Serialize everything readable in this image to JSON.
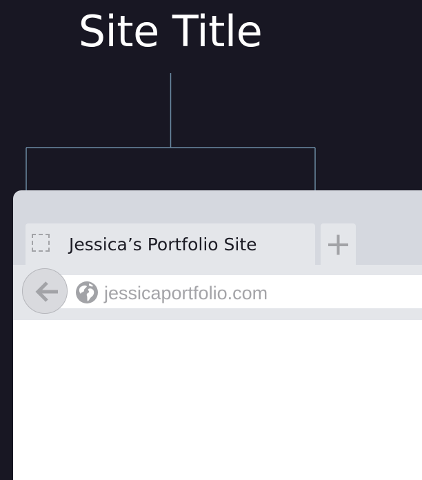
{
  "annotation": {
    "label": "Site Title"
  },
  "browser": {
    "active_tab": {
      "title": "Jessica’s Portfolio Site",
      "favicon": "dashed-square-placeholder-icon"
    },
    "new_tab_icon": "plus-icon",
    "address_bar": {
      "url": "jessicaportfolio.com",
      "site_icon": "globe-icon"
    },
    "back_icon": "arrow-left-icon"
  },
  "colors": {
    "background": "#181723",
    "bracket_line": "#6a8aa3",
    "window_chrome": "#d5d8df",
    "tab_fill": "#e4e6ea",
    "tab_text": "#1b1b24",
    "url_text": "#a4a4a8",
    "icon_gray": "#a2a3a7"
  }
}
